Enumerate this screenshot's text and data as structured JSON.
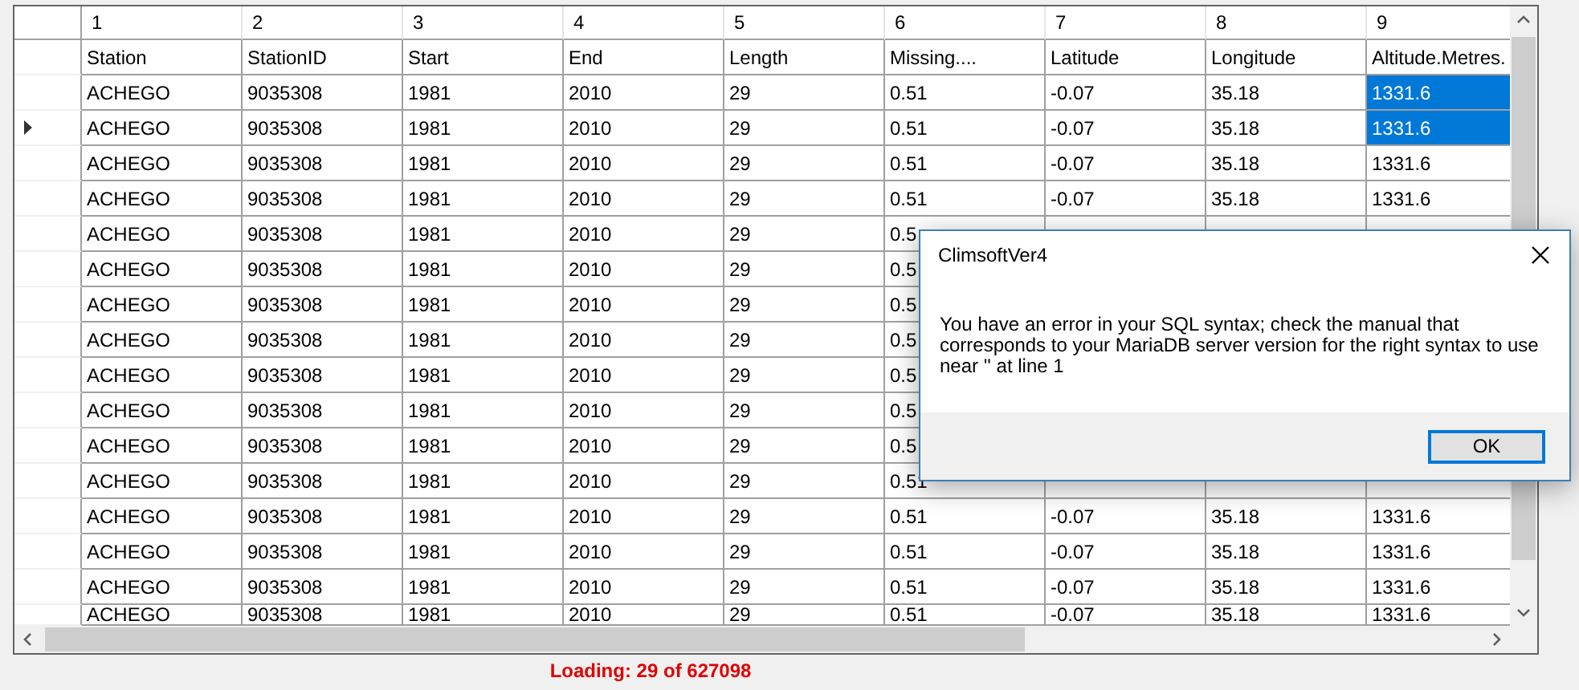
{
  "grid": {
    "columns": [
      "1",
      "2",
      "3",
      "4",
      "5",
      "6",
      "7",
      "8",
      "9"
    ],
    "rows": [
      {
        "current": false,
        "last_cell_selected": false,
        "cells": [
          "Station",
          "StationID",
          "Start",
          "End",
          "Length",
          "Missing....",
          "Latitude",
          "Longitude",
          "Altitude.Metres."
        ]
      },
      {
        "current": false,
        "last_cell_selected": true,
        "cells": [
          "ACHEGO",
          "9035308",
          "1981",
          "2010",
          "29",
          "0.51",
          "-0.07",
          "35.18",
          "1331.6"
        ]
      },
      {
        "current": true,
        "last_cell_selected": true,
        "cells": [
          "ACHEGO",
          "9035308",
          "1981",
          "2010",
          "29",
          "0.51",
          "-0.07",
          "35.18",
          "1331.6"
        ]
      },
      {
        "current": false,
        "last_cell_selected": false,
        "cells": [
          "ACHEGO",
          "9035308",
          "1981",
          "2010",
          "29",
          "0.51",
          "-0.07",
          "35.18",
          "1331.6"
        ]
      },
      {
        "current": false,
        "last_cell_selected": false,
        "cells": [
          "ACHEGO",
          "9035308",
          "1981",
          "2010",
          "29",
          "0.51",
          "-0.07",
          "35.18",
          "1331.6"
        ]
      },
      {
        "current": false,
        "cells": [
          "ACHEGO",
          "9035308",
          "1981",
          "2010",
          "29",
          "0.5"
        ]
      },
      {
        "current": false,
        "cells": [
          "ACHEGO",
          "9035308",
          "1981",
          "2010",
          "29",
          "0.5"
        ]
      },
      {
        "current": false,
        "cells": [
          "ACHEGO",
          "9035308",
          "1981",
          "2010",
          "29",
          "0.5"
        ]
      },
      {
        "current": false,
        "cells": [
          "ACHEGO",
          "9035308",
          "1981",
          "2010",
          "29",
          "0.5"
        ]
      },
      {
        "current": false,
        "cells": [
          "ACHEGO",
          "9035308",
          "1981",
          "2010",
          "29",
          "0.5"
        ]
      },
      {
        "current": false,
        "cells": [
          "ACHEGO",
          "9035308",
          "1981",
          "2010",
          "29",
          "0.5"
        ]
      },
      {
        "current": false,
        "cells": [
          "ACHEGO",
          "9035308",
          "1981",
          "2010",
          "29",
          "0.5"
        ]
      },
      {
        "current": false,
        "cells": [
          "ACHEGO",
          "9035308",
          "1981",
          "2010",
          "29",
          "0.51"
        ]
      },
      {
        "current": false,
        "last_cell_selected": false,
        "cells": [
          "ACHEGO",
          "9035308",
          "1981",
          "2010",
          "29",
          "0.51",
          "-0.07",
          "35.18",
          "1331.6"
        ]
      },
      {
        "current": false,
        "last_cell_selected": false,
        "cells": [
          "ACHEGO",
          "9035308",
          "1981",
          "2010",
          "29",
          "0.51",
          "-0.07",
          "35.18",
          "1331.6"
        ]
      },
      {
        "current": false,
        "last_cell_selected": false,
        "cells": [
          "ACHEGO",
          "9035308",
          "1981",
          "2010",
          "29",
          "0.51",
          "-0.07",
          "35.18",
          "1331.6"
        ]
      },
      {
        "current": false,
        "last_cell_selected": false,
        "cells": [
          "ACHEGO",
          "9035308",
          "1981",
          "2010",
          "29",
          "0.51",
          "-0.07",
          "35.18",
          "1331.6"
        ]
      }
    ]
  },
  "status": "Loading: 29 of 627098",
  "dialog": {
    "title": "ClimsoftVer4",
    "message": "You have an error in your SQL syntax; check the manual that corresponds to your MariaDB server version for the right syntax to use near '' at line 1",
    "button": "OK"
  }
}
